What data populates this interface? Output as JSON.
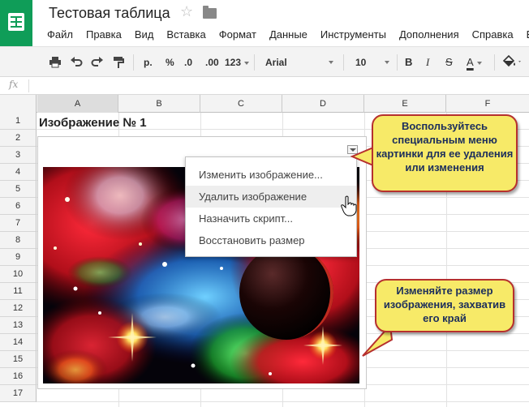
{
  "app": {
    "title": "Тестовая таблица",
    "accent_color": "#0f9d58",
    "star_icon": "☆"
  },
  "menu": [
    "Файл",
    "Правка",
    "Вид",
    "Вставка",
    "Формат",
    "Данные",
    "Инструменты",
    "Дополнения",
    "Справка",
    "Е"
  ],
  "toolbar": {
    "currency": "р.",
    "percent": "%",
    "decimal_decrease": ".0",
    "decimal_increase": ".00",
    "number_format": "123",
    "font": "Arial",
    "font_size": "10",
    "bold": "B",
    "italic": "I",
    "strike": "S",
    "text_color_label": "A"
  },
  "formula_bar": {
    "label": "fx",
    "value": ""
  },
  "columns": [
    "A",
    "B",
    "C",
    "D",
    "E",
    "F"
  ],
  "rows": [
    "1",
    "2",
    "3",
    "4",
    "5",
    "6",
    "7",
    "8",
    "9",
    "10",
    "11",
    "12",
    "13",
    "14",
    "15",
    "16",
    "17"
  ],
  "cells": {
    "A1": "Изображение № 1"
  },
  "image_menu": {
    "items": [
      {
        "label": "Изменить изображение..."
      },
      {
        "label": "Удалить изображение",
        "hovered": true
      },
      {
        "label": "Назначить скрипт..."
      },
      {
        "label": "Восстановить размер"
      }
    ]
  },
  "callouts": {
    "menu_tip": "Воспользуйтесь специальным меню картинки для ее удаления или изменения",
    "resize_tip": "Изменяйте размер изображения, захватив его край"
  }
}
